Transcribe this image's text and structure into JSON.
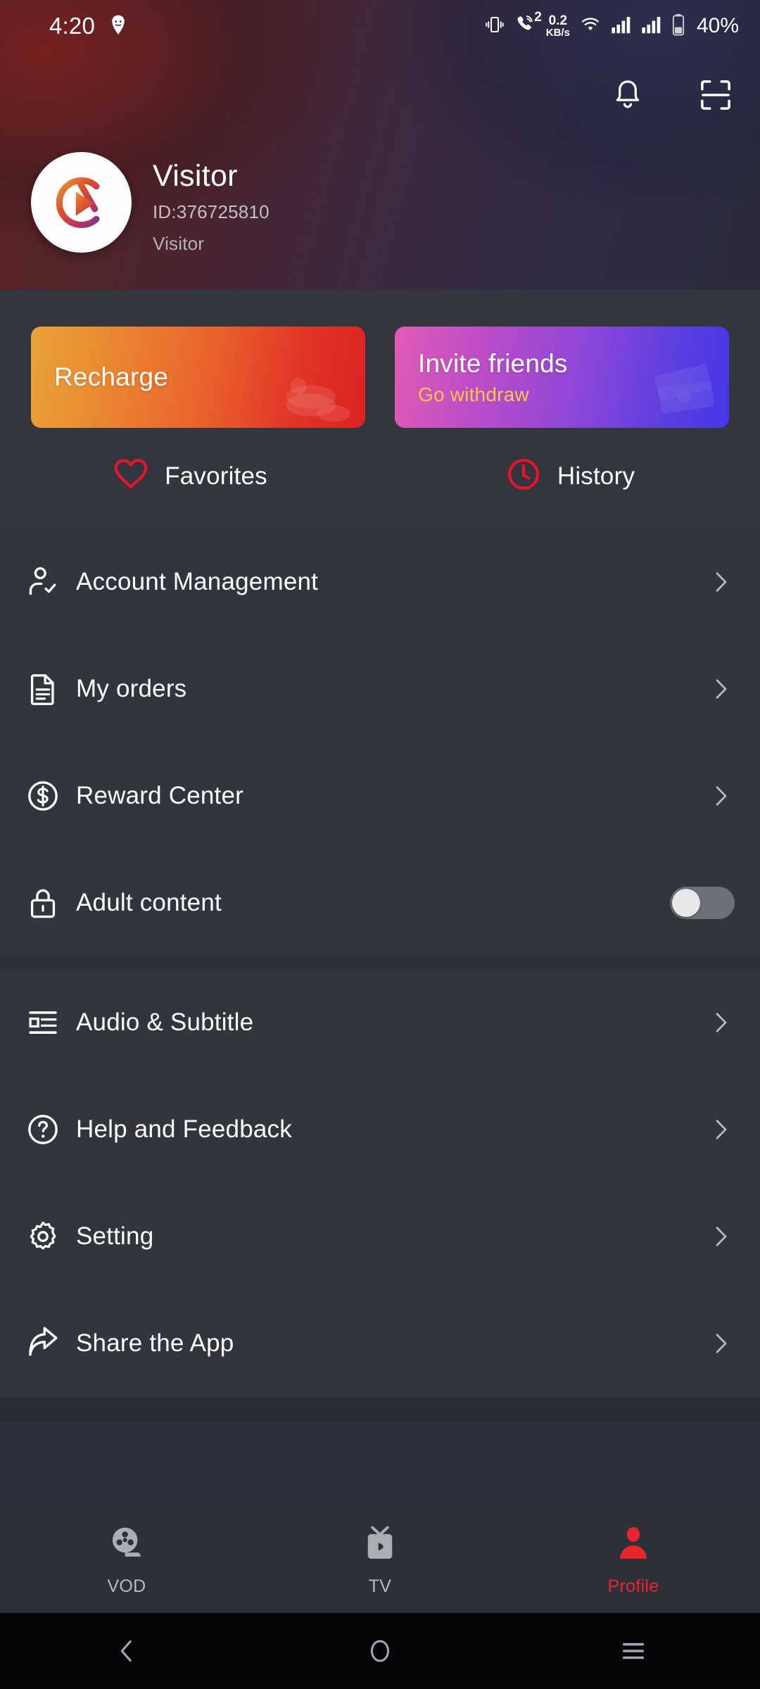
{
  "status_bar": {
    "time": "4:20",
    "face_icon": "face-mask-icon",
    "vibrate_icon": "vibrate-icon",
    "call_icon": "call-forward-icon",
    "call_badge": "2",
    "net_speed_value": "0.2",
    "net_speed_unit": "KB/s",
    "wifi_icon": "wifi-icon",
    "signal1_icon": "signal-bars-icon",
    "signal2_icon": "signal-bars-icon",
    "battery_icon": "battery-icon",
    "battery_percent": "40%"
  },
  "header": {
    "notification_icon": "bell-icon",
    "scan_icon": "qr-scan-icon",
    "avatar_icon": "app-logo-avatar-icon",
    "user_name": "Visitor",
    "user_id": "ID:376725810",
    "user_role": "Visitor"
  },
  "banners": [
    {
      "id": "recharge",
      "title": "Recharge",
      "subtitle": "",
      "art_icon": "coins-icon",
      "gradient_from": "#e8a33a",
      "gradient_to": "#dc2322"
    },
    {
      "id": "invite",
      "title": "Invite friends",
      "subtitle": "Go withdraw",
      "art_icon": "cash-icon",
      "gradient_from": "#e05bb4",
      "gradient_to": "#4436e6",
      "subtitle_color": "#ffc54d"
    }
  ],
  "quick_links": [
    {
      "id": "favorites",
      "label": "Favorites",
      "icon": "heart-icon",
      "color": "#e8142b"
    },
    {
      "id": "history",
      "label": "History",
      "icon": "clock-icon",
      "color": "#e8142b"
    }
  ],
  "menu_groups": [
    {
      "id": "group-account",
      "items": [
        {
          "id": "account-management",
          "label": "Account Management",
          "icon": "user-check-icon",
          "accessory": "chevron"
        },
        {
          "id": "my-orders",
          "label": "My orders",
          "icon": "document-icon",
          "accessory": "chevron"
        },
        {
          "id": "reward-center",
          "label": "Reward Center",
          "icon": "dollar-circle-icon",
          "accessory": "chevron"
        },
        {
          "id": "adult-content",
          "label": "Adult content",
          "icon": "lock-icon",
          "accessory": "toggle",
          "toggle_on": false
        }
      ]
    },
    {
      "id": "group-prefs",
      "items": [
        {
          "id": "audio-subtitle",
          "label": "Audio & Subtitle",
          "icon": "subtitle-icon",
          "accessory": "chevron"
        },
        {
          "id": "help-feedback",
          "label": "Help and Feedback",
          "icon": "question-circle-icon",
          "accessory": "chevron"
        },
        {
          "id": "setting",
          "label": "Setting",
          "icon": "gear-icon",
          "accessory": "chevron"
        },
        {
          "id": "share-app",
          "label": "Share the App",
          "icon": "share-arrow-icon",
          "accessory": "chevron"
        }
      ]
    }
  ],
  "bottom_nav": {
    "active_color": "#e8242d",
    "inactive_color": "#b9b9c0",
    "items": [
      {
        "id": "vod",
        "label": "VOD",
        "icon": "film-reel-icon",
        "active": false
      },
      {
        "id": "tv",
        "label": "TV",
        "icon": "tv-icon",
        "active": false
      },
      {
        "id": "profile",
        "label": "Profile",
        "icon": "person-icon",
        "active": true
      }
    ]
  },
  "android_nav": {
    "back_icon": "back-chevron-icon",
    "home_icon": "home-circle-icon",
    "recents_icon": "recents-menu-icon"
  }
}
